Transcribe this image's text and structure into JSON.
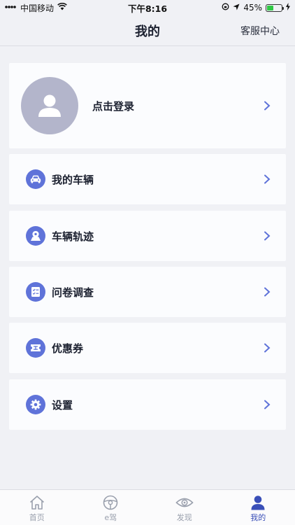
{
  "status_bar": {
    "carrier": "中国移动",
    "time": "下午8:16",
    "battery_percent": "45%",
    "battery_level": 0.45
  },
  "nav": {
    "title": "我的",
    "right_action": "客服中心"
  },
  "profile": {
    "login_label": "点击登录"
  },
  "menu": {
    "items": [
      {
        "label": "我的车辆",
        "icon": "car-icon"
      },
      {
        "label": "车辆轨迹",
        "icon": "map-pin-icon"
      },
      {
        "label": "问卷调查",
        "icon": "survey-icon"
      },
      {
        "label": "优惠券",
        "icon": "coupon-icon"
      },
      {
        "label": "设置",
        "icon": "gear-icon"
      }
    ]
  },
  "tabbar": {
    "tabs": [
      {
        "label": "首页",
        "icon": "home-icon",
        "active": false
      },
      {
        "label": "e驾",
        "icon": "steering-wheel-icon",
        "active": false
      },
      {
        "label": "发现",
        "icon": "eye-icon",
        "active": false
      },
      {
        "label": "我的",
        "icon": "user-icon",
        "active": true
      }
    ]
  },
  "colors": {
    "accent": "#5f73d9",
    "active_tab": "#3a4fb8",
    "background": "#f0f1f5",
    "avatar_bg": "#b3b5cb"
  }
}
